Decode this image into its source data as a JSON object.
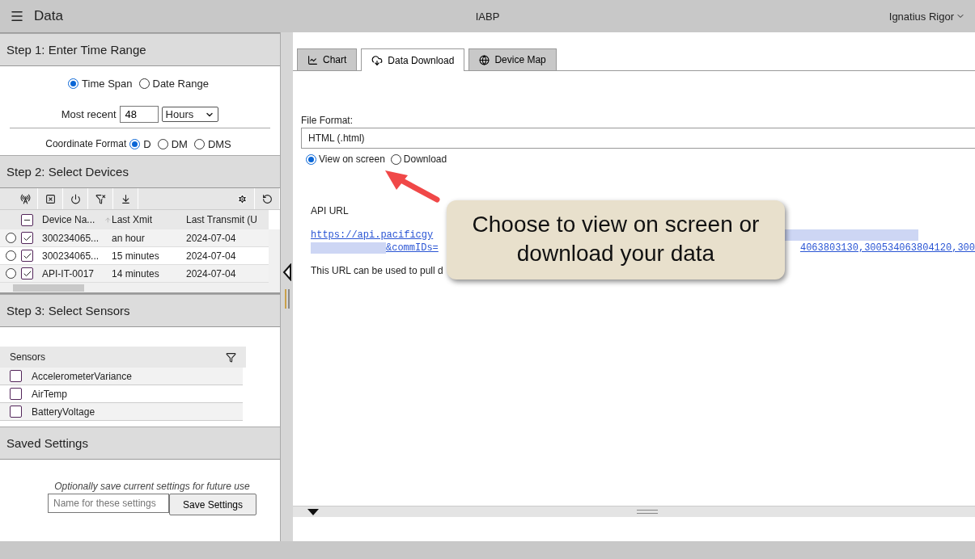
{
  "header": {
    "title": "Data",
    "app_name": "IABP",
    "user": "Ignatius Rigor"
  },
  "step1": {
    "title": "Step 1: Enter Time Range",
    "range_modes": [
      {
        "label": "Time Span",
        "selected": true
      },
      {
        "label": "Date Range",
        "selected": false
      }
    ],
    "recent_label": "Most recent",
    "recent_value": "48",
    "unit": "Hours",
    "coord_label": "Coordinate Format",
    "coord_formats": [
      {
        "label": "D",
        "selected": true
      },
      {
        "label": "DM",
        "selected": false
      },
      {
        "label": "DMS",
        "selected": false
      }
    ]
  },
  "step2": {
    "title": "Step 2: Select Devices",
    "columns": [
      "Device Na...",
      "Last Xmit",
      "Last Transmit (U"
    ],
    "select_all_indeterminate": true,
    "rows": [
      {
        "selected": false,
        "checked": true,
        "cells": [
          "300234065...",
          "an hour",
          "2024-07-04"
        ]
      },
      {
        "selected": false,
        "checked": true,
        "cells": [
          "300234065...",
          "15 minutes",
          "2024-07-04"
        ]
      },
      {
        "selected": false,
        "checked": true,
        "cells": [
          "API-IT-0017",
          "14 minutes",
          "2024-07-04"
        ]
      }
    ]
  },
  "step3": {
    "title": "Step 3: Select Sensors",
    "column": "Sensors",
    "sensors": [
      {
        "label": "AccelerometerVariance",
        "checked": false
      },
      {
        "label": "AirTemp",
        "checked": false
      },
      {
        "label": "BatteryVoltage",
        "checked": false
      }
    ]
  },
  "saved": {
    "title": "Saved Settings",
    "hint": "Optionally save current settings for future use",
    "placeholder": "Name for these settings",
    "button": "Save Settings"
  },
  "tabs": [
    {
      "label": "Chart",
      "kind": "chart",
      "selected": false
    },
    {
      "label": "Data Download",
      "kind": "download",
      "selected": true
    },
    {
      "label": "Device Map",
      "kind": "map",
      "selected": false
    }
  ],
  "download": {
    "format_label": "File Format:",
    "format_value": "HTML (.html)",
    "output_modes": [
      {
        "label": "View on screen",
        "selected": true
      },
      {
        "label": "Download",
        "selected": false
      }
    ],
    "api_label": "API URL",
    "url_start": "https://api.pacificgy",
    "url_param": "&commIDs=",
    "url_end": "4063803130,300534063804120,300",
    "note": "This URL can be used to pull d"
  },
  "callout": "Choose to view on screen or download your data"
}
